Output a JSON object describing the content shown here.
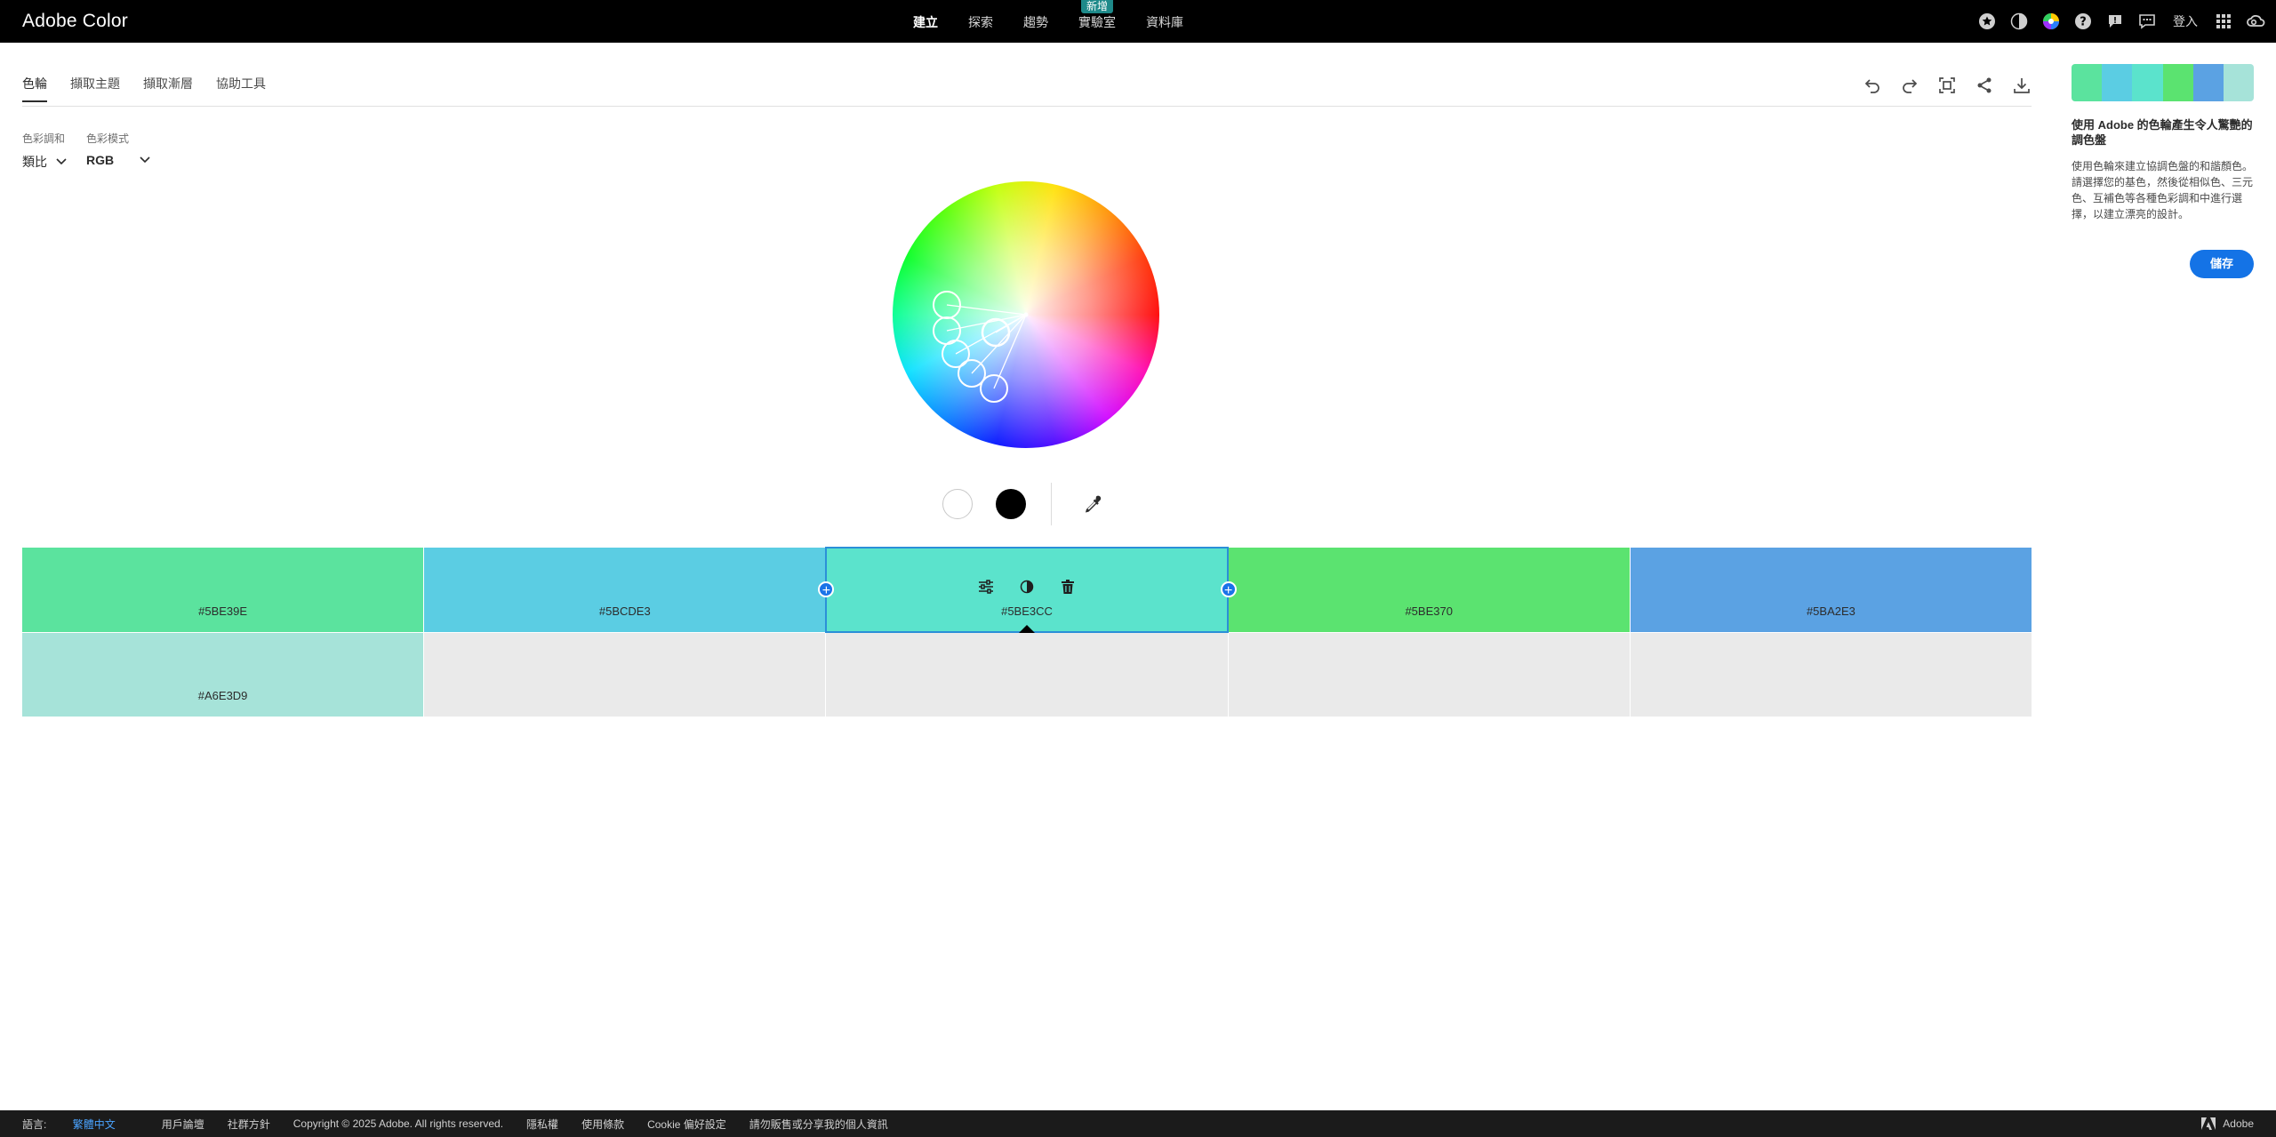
{
  "header": {
    "brand": "Adobe Color",
    "nav": [
      {
        "label": "建立",
        "active": true
      },
      {
        "label": "探索"
      },
      {
        "label": "趨勢"
      },
      {
        "label": "實驗室",
        "badge": "新增"
      },
      {
        "label": "資料庫"
      }
    ],
    "signin": "登入"
  },
  "tabs": [
    "色輪",
    "擷取主題",
    "擷取漸層",
    "協助工具"
  ],
  "selectors": {
    "harmony_label": "色彩調和",
    "harmony_value": "類比",
    "mode_label": "色彩模式",
    "mode_value": "RGB"
  },
  "palette": {
    "colors": [
      {
        "hex": "#5BE39E"
      },
      {
        "hex": "#5BCDE3"
      },
      {
        "hex": "#5BE3CC",
        "selected": true
      },
      {
        "hex": "#5BE370"
      },
      {
        "hex": "#5BA2E3"
      }
    ],
    "shades": [
      {
        "hex": "#A6E3D9"
      }
    ]
  },
  "sidebar": {
    "strip": [
      "#5BE39E",
      "#5BCDE3",
      "#5BE3CC",
      "#5BE370",
      "#5BA2E3",
      "#A6E3D9"
    ],
    "title": "使用 Adobe 的色輪產生令人驚艷的調色盤",
    "desc": "使用色輪來建立協調色盤的和諧顏色。請選擇您的基色，然後從相似色、三元色、互補色等各種色彩調和中進行選擇，以建立漂亮的設計。",
    "save": "儲存"
  },
  "footer": {
    "lang_prefix": "語言:",
    "lang": "繁體中文",
    "links": [
      "用戶論壇",
      "社群方針",
      "Copyright © 2025 Adobe. All rights reserved.",
      "隱私權",
      "使用條款",
      "Cookie 偏好設定",
      "請勿販售或分享我的個人資訊"
    ],
    "adobe": "Adobe"
  },
  "icons": {
    "top": [
      "star-icon",
      "contrast-icon",
      "color-wheel-icon",
      "help-icon",
      "feedback-icon",
      "chat-icon"
    ],
    "tools": [
      "undo-icon",
      "redo-icon",
      "fit-icon",
      "share-icon",
      "download-icon"
    ]
  }
}
